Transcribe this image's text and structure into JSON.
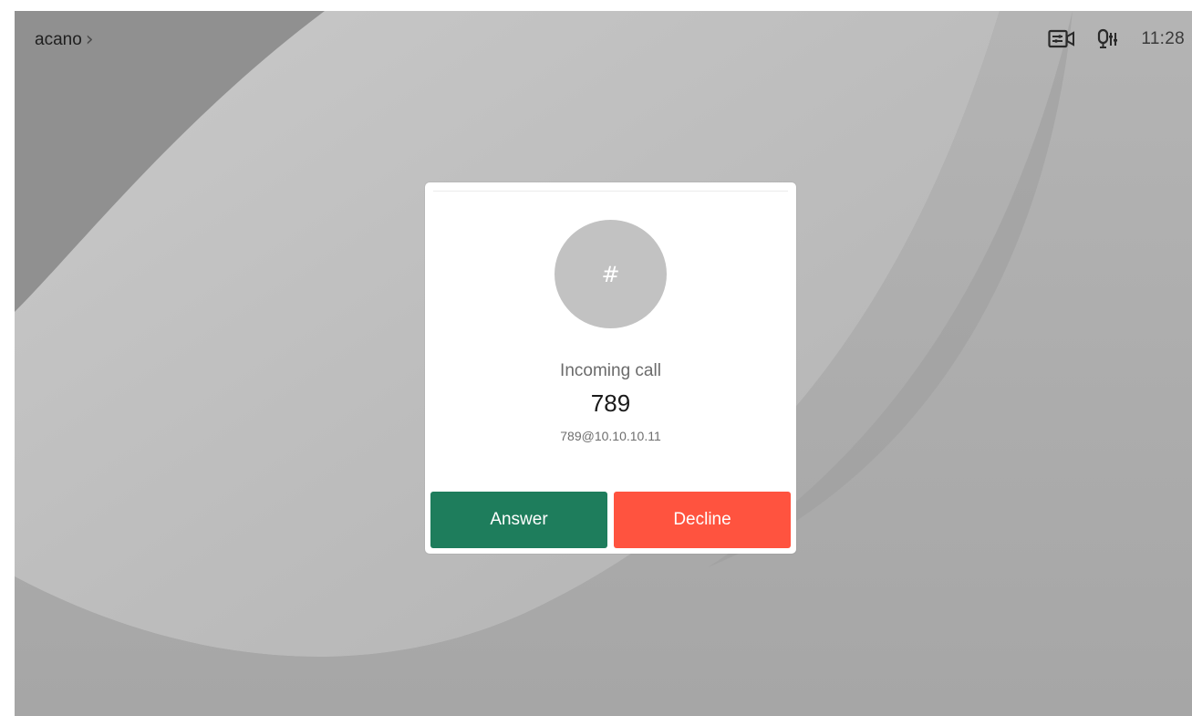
{
  "topbar": {
    "device_name": "acano",
    "chevron": "›",
    "time": "11:28",
    "icons": {
      "selfview": "selfview-camera-icon",
      "mic": "microphone-settings-icon",
      "chevron": "chevron-right-icon"
    }
  },
  "incoming_call": {
    "avatar_symbol": "#",
    "status": "Incoming call",
    "caller_name": "789",
    "caller_uri": "789@10.10.10.11",
    "answer_label": "Answer",
    "decline_label": "Decline"
  },
  "colors": {
    "answer": "#1e7d5c",
    "decline": "#ff533f",
    "avatar": "#c2c2c2",
    "wallpaper": "#a2a2a2"
  }
}
